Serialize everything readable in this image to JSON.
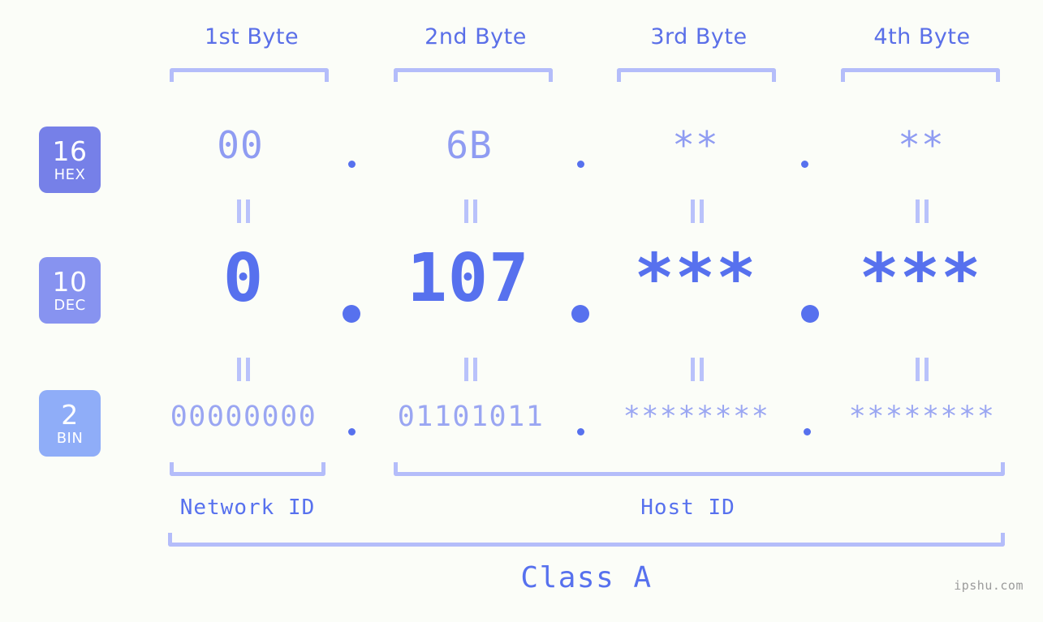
{
  "colors": {
    "background": "#fbfdf8",
    "accent_strong": "#5771ee",
    "accent_mid": "#8f9cf2",
    "accent_light": "#b4bdfa",
    "badge_hex": "#7680e8",
    "badge_dec": "#8793f0",
    "badge_bin": "#8fadf8",
    "watermark": "#9b9b9b"
  },
  "byte_headers": [
    {
      "label": "1st Byte"
    },
    {
      "label": "2nd Byte"
    },
    {
      "label": "3rd Byte"
    },
    {
      "label": "4th Byte"
    }
  ],
  "radix_badges": [
    {
      "number": "16",
      "name": "HEX"
    },
    {
      "number": "10",
      "name": "DEC"
    },
    {
      "number": "2",
      "name": "BIN"
    }
  ],
  "rows": {
    "hex": {
      "radix": "16",
      "radix_name": "HEX",
      "values": [
        "00",
        "6B",
        "**",
        "**"
      ],
      "separator": "."
    },
    "dec": {
      "radix": "10",
      "radix_name": "DEC",
      "values": [
        "0",
        "107",
        "***",
        "***"
      ],
      "separator": "."
    },
    "bin": {
      "radix": "2",
      "radix_name": "BIN",
      "values": [
        "00000000",
        "01101011",
        "********",
        "********"
      ],
      "separator": "."
    }
  },
  "equality_marks": {
    "symbol": "||",
    "count_per_gap": 4
  },
  "sections": {
    "network_id": "Network ID",
    "host_id": "Host ID",
    "class": "Class A"
  },
  "watermark": "ipshu.com"
}
